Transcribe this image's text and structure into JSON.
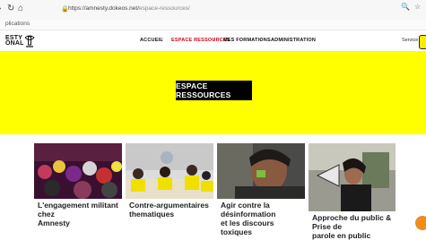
{
  "browser": {
    "url_domain": "https://amnesty.dokeos.net/",
    "url_path": "espace-ressources/",
    "bookmarks_label": "plications"
  },
  "header": {
    "logo_line1": "ESTY",
    "logo_line2": "ONAL",
    "menu": [
      {
        "label": "ACCUEIL"
      },
      {
        "label": "ESPACE RESSOURCES"
      },
      {
        "label": "MES FORMATIONS"
      },
      {
        "label": "ADMINISTRATION"
      }
    ],
    "separator": "/",
    "service_label": "Service"
  },
  "hero": {
    "title": "ESPACE RESSOURCES"
  },
  "cards": [
    {
      "title_line1": "L'engagement militant chez",
      "title_line2": "Amnesty"
    },
    {
      "title_line1": "Contre-argumentaires",
      "title_line2": "thematiques"
    },
    {
      "title_line1": "Agir contre la désinformation",
      "title_line2": "et les discours toxiques"
    },
    {
      "title_line1": "Approche du public & Prise de",
      "title_line2": "parole en public"
    }
  ],
  "colors": {
    "accent_yellow": "#ffff00",
    "active_red": "#d0021b"
  }
}
